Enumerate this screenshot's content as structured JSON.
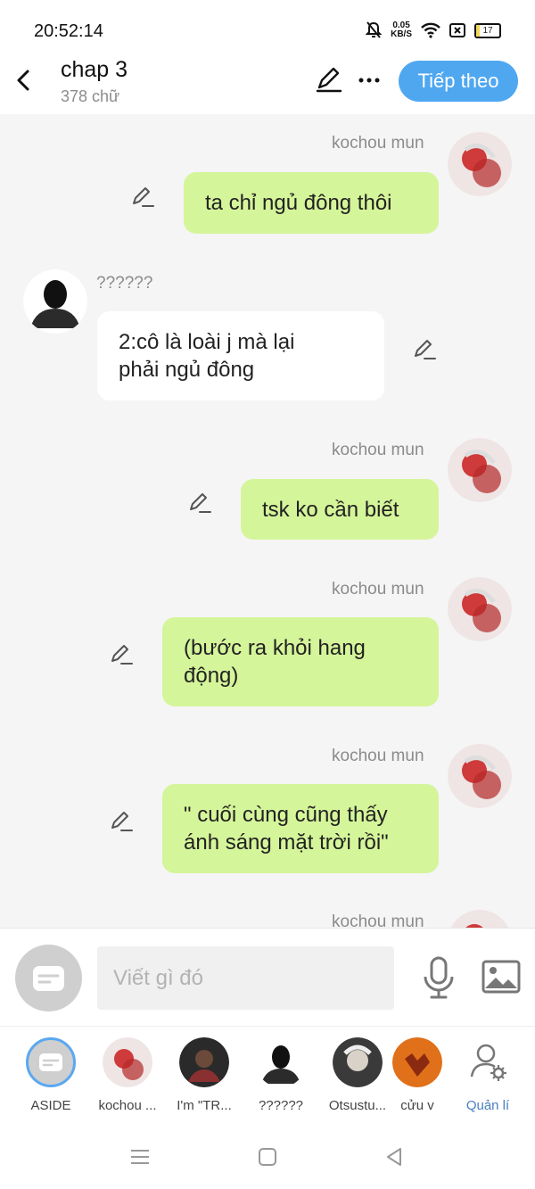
{
  "status_bar": {
    "time": "20:52:14",
    "net_speed_value": "0.05",
    "net_speed_unit": "KB/S",
    "battery": "17",
    "battery_level_percent": 17
  },
  "header": {
    "title": "chap 3",
    "word_count": "378 chữ",
    "next_button": "Tiếp theo"
  },
  "messages": [
    {
      "sender": "kochou mun",
      "side": "right",
      "text": "ta chỉ ngủ đông thôi"
    },
    {
      "sender": "??????",
      "side": "left",
      "text": "2:cô là loài j mà lại\nphải ngủ đông"
    },
    {
      "sender": "kochou mun",
      "side": "right",
      "text": "tsk ko cần biết"
    },
    {
      "sender": "kochou mun",
      "side": "right",
      "text": "(bước ra khỏi hang\nđộng)"
    },
    {
      "sender": "kochou mun",
      "side": "right",
      "text": "\" cuối cùng cũng thấy\nánh sáng mặt trời rồi\""
    },
    {
      "sender": "kochou mun",
      "side": "right",
      "text": ""
    }
  ],
  "composer": {
    "placeholder": "Viết gì đó"
  },
  "characters": [
    {
      "label": "ASIDE"
    },
    {
      "label": "kochou ..."
    },
    {
      "label": "I'm \"TR..."
    },
    {
      "label": "??????"
    },
    {
      "label": "Otsustu..."
    },
    {
      "label": "cửu v"
    },
    {
      "label": "Quản lí"
    }
  ],
  "colors": {
    "accent": "#4fa7f0",
    "my_bubble": "#d5f59a",
    "their_bubble": "#ffffff",
    "background": "#f5f5f5"
  }
}
